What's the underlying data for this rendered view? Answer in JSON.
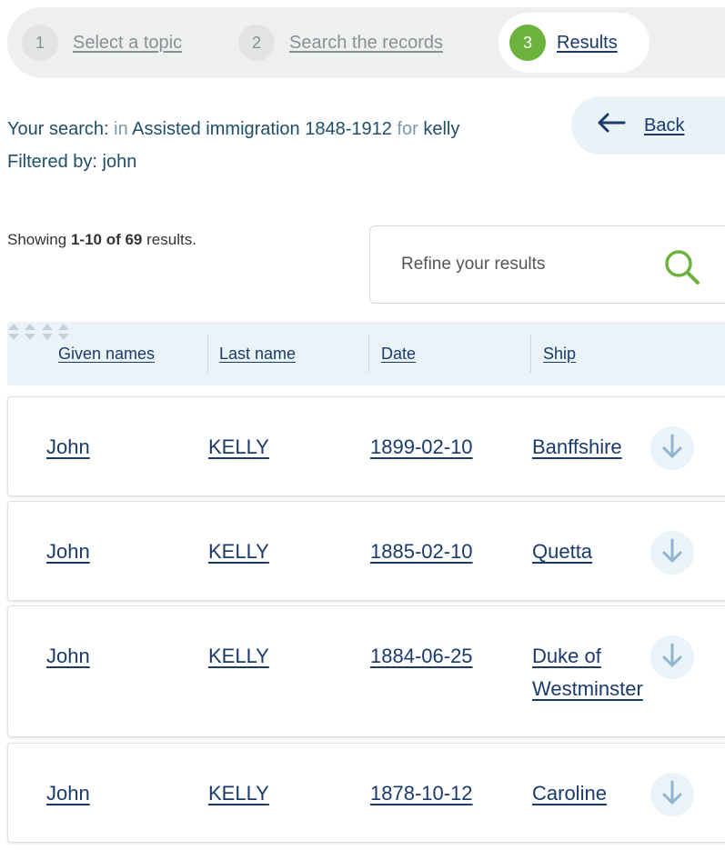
{
  "stepper": {
    "steps": [
      {
        "num": "1",
        "label": "Select a topic"
      },
      {
        "num": "2",
        "label": "Search the records"
      },
      {
        "num": "3",
        "label": "Results"
      }
    ]
  },
  "summary": {
    "prefix": "Your search:",
    "in_word": "in",
    "dataset": "Assisted immigration 1848-1912",
    "for_word": "for",
    "term": "kelly",
    "filter_label": "Filtered by:",
    "filter_value": "john"
  },
  "back": {
    "label": "Back"
  },
  "showing": {
    "prefix": "Showing",
    "range": "1-10 of 69",
    "suffix": "results."
  },
  "refine": {
    "placeholder": "Refine your results"
  },
  "table": {
    "headers": [
      "Given names",
      "Last name",
      "Date",
      "Ship"
    ],
    "rows": [
      {
        "given": "John",
        "last": "KELLY",
        "date": "1899-02-10",
        "ship": "Banffshire"
      },
      {
        "given": "John",
        "last": "KELLY",
        "date": "1885-02-10",
        "ship": "Quetta"
      },
      {
        "given": "John",
        "last": "KELLY",
        "date": "1884-06-25",
        "ship": "Duke of Westminster"
      },
      {
        "given": "John",
        "last": "KELLY",
        "date": "1878-10-12",
        "ship": "Caroline"
      }
    ]
  },
  "colors": {
    "accent_green": "#6cb33e",
    "link_navy": "#1a3a6b",
    "header_bg": "#eaf3f8"
  }
}
